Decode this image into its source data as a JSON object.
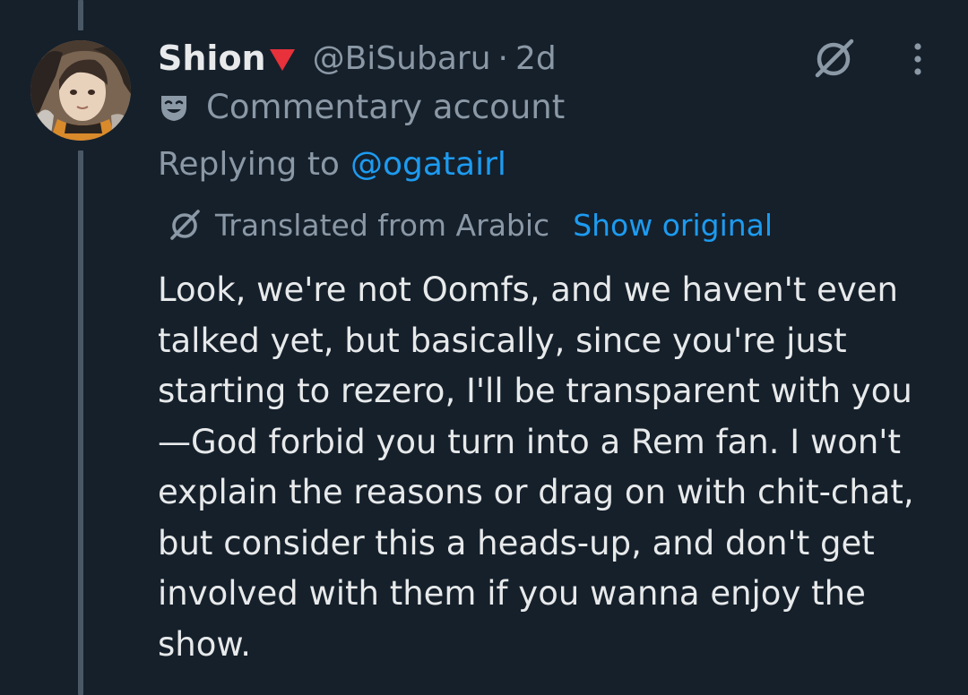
{
  "tweet": {
    "display_name": "Shion",
    "handle": "@BiSubaru",
    "separator": "·",
    "time": "2d",
    "label": "Commentary account",
    "reply": {
      "prefix": "Replying to",
      "handle": "@ogatairl"
    },
    "translation": {
      "text": "Translated from Arabic",
      "link": "Show original"
    },
    "body": "Look, we're not Oomfs, and we haven't even\ntalked yet, but basically, since you're just\nstarting to rezero, I'll be transparent with you\n—God forbid you turn into a Rem fan. I won't\nexplain the reasons or drag on with chit-chat,\nbut consider this a heads-up, and don't get\ninvolved with them if you wanna enjoy the\nshow."
  },
  "icons": {
    "flag": "red-triangle-down-icon",
    "grok": "grok-slash-icon",
    "more": "more-vertical-icon",
    "label": "theater-mask-icon",
    "translate": "grok-slash-icon"
  },
  "colors": {
    "background": "#15202b",
    "primary_text": "#e7e9ea",
    "secondary_text": "#8b98a5",
    "link": "#1d9bf0",
    "flag": "#e8313a"
  }
}
